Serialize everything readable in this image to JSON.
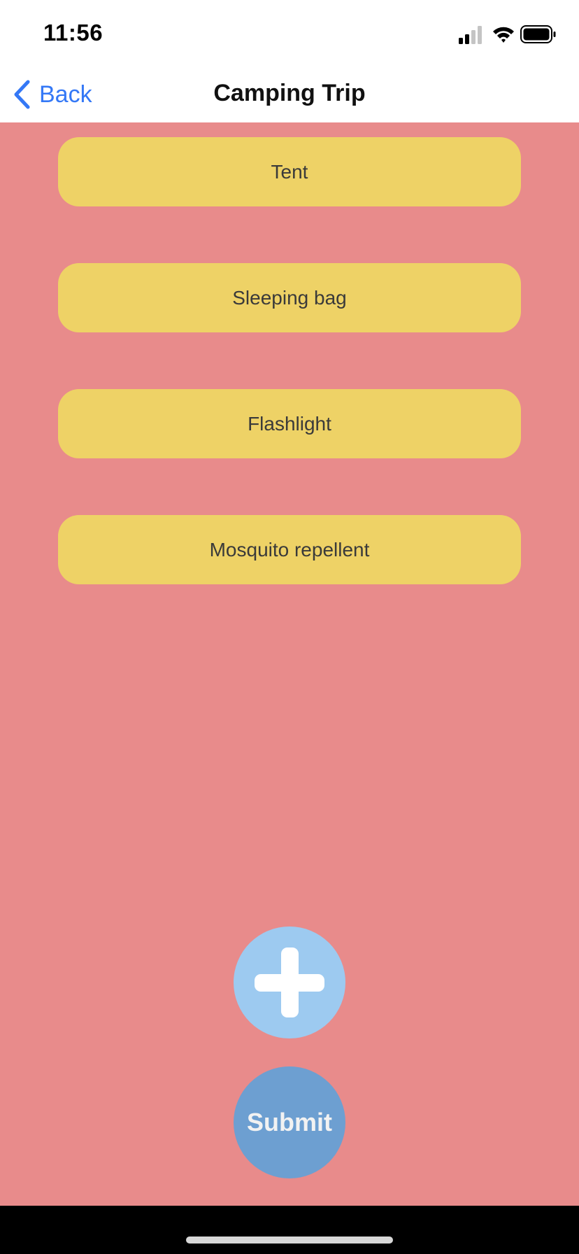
{
  "status_bar": {
    "time": "11:56"
  },
  "nav": {
    "back_label": "Back",
    "title": "Camping Trip"
  },
  "items": [
    {
      "label": "Tent"
    },
    {
      "label": "Sleeping bag"
    },
    {
      "label": "Flashlight"
    },
    {
      "label": "Mosquito repellent"
    }
  ],
  "actions": {
    "add_icon": "plus-icon",
    "submit_label": "Submit"
  },
  "colors": {
    "background": "#e88b8b",
    "item": "#eed266",
    "add_button": "#9dcaf0",
    "submit_button": "#6d9fd1",
    "back_link": "#3478f6"
  }
}
